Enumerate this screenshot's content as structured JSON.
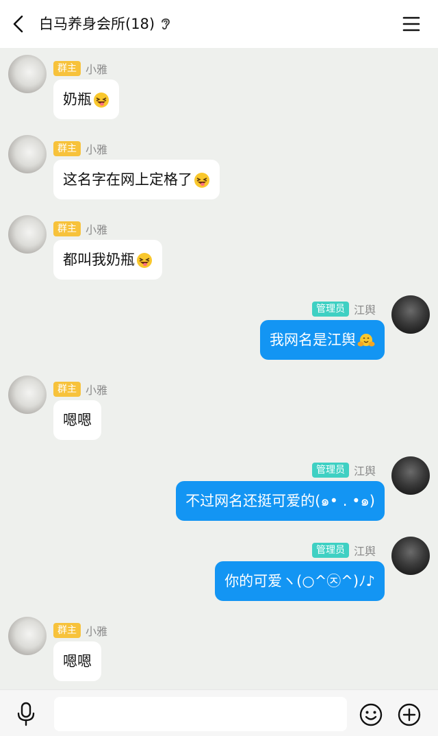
{
  "header": {
    "title": "白马养身会所(18)"
  },
  "colors": {
    "chat_background": "#eef0ed",
    "own_bubble": "#1395f3",
    "owner_badge": "#f7c23b",
    "admin_badge": "#3fd0c3"
  },
  "messages": [
    {
      "side": "left",
      "badge": "群主",
      "sender": "小雅",
      "text": "奶瓶",
      "emoji": "laughing-tongue-emoji"
    },
    {
      "side": "left",
      "badge": "群主",
      "sender": "小雅",
      "text": "这名字在网上定格了",
      "emoji": "laughing-tongue-emoji"
    },
    {
      "side": "left",
      "badge": "群主",
      "sender": "小雅",
      "text": "都叫我奶瓶",
      "emoji": "laughing-tongue-emoji"
    },
    {
      "side": "right",
      "badge": "管理员",
      "sender": "江舆",
      "text": "我网名是江舆",
      "emoji": "hugging-emoji"
    },
    {
      "side": "left",
      "badge": "群主",
      "sender": "小雅",
      "text": "嗯嗯"
    },
    {
      "side": "right",
      "badge": "管理员",
      "sender": "江舆",
      "text": "不过网名还挺可爱的(๑• . •๑)"
    },
    {
      "side": "right",
      "badge": "管理员",
      "sender": "江舆",
      "text": "你的可爱ヽ(○^㉨^)ﾉ♪"
    },
    {
      "side": "left",
      "badge": "群主",
      "sender": "小雅",
      "text": "嗯嗯"
    }
  ],
  "input": {
    "placeholder": ""
  }
}
